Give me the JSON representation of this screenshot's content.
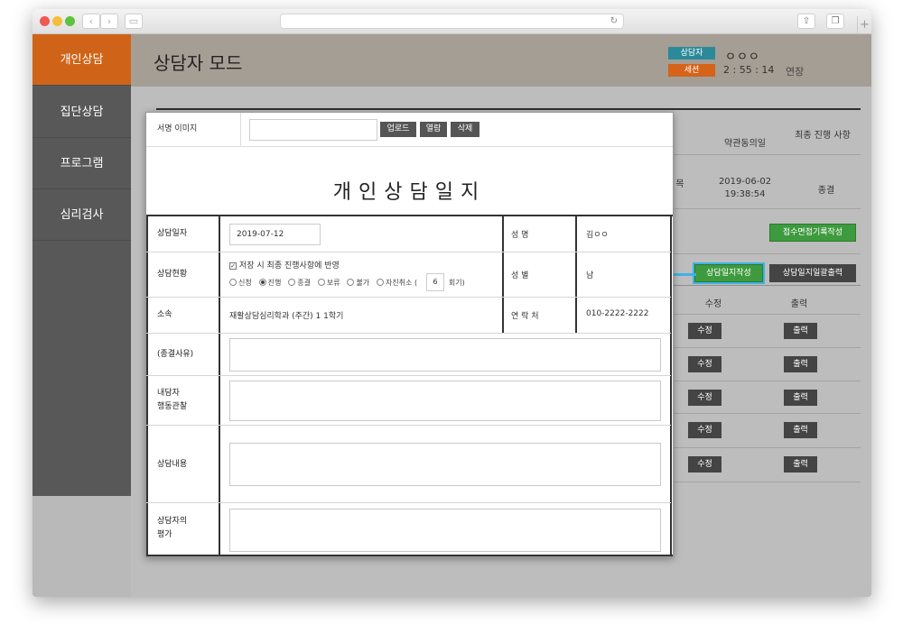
{
  "sidebar": {
    "items": [
      {
        "label": "개인상담"
      },
      {
        "label": "집단상담"
      },
      {
        "label": "프로그램"
      },
      {
        "label": "심리검사"
      }
    ]
  },
  "header": {
    "title": "상담자 모드",
    "counselor_badge": "상담자",
    "counselor_name": "ㅇㅇㅇ",
    "session_badge": "세션",
    "session_time": "2 : 55 : 14",
    "extend_label": "연장"
  },
  "background_table": {
    "col_consent": "약관동의일",
    "col_final": "최종 진행 사항",
    "partial_cell": "목",
    "consent_date": "2019-06-02 19:38:54",
    "final_status": "종결",
    "intake_button": "접수면접기록작성",
    "log_write_button": "상담일지작성",
    "log_print_all_button": "상담일지일괄출력",
    "col_edit": "수정",
    "col_print": "출력",
    "edit_label": "수정",
    "print_label": "출력",
    "row_count": 5
  },
  "modal": {
    "signature_label": "서명 이미지",
    "upload_button": "업로드",
    "view_button": "열람",
    "delete_button": "삭제",
    "form_title": "개인상담일지",
    "rows": {
      "date_label": "상담일자",
      "date_value": "2019-07-12",
      "name_label": "성    명",
      "name_value": "김ㅇㅇ",
      "status_label": "상담현황",
      "save_checkbox_label": "저장 시 최종 진행사항에 반영",
      "status_options": [
        "신청",
        "진행",
        "종결",
        "보류",
        "불가",
        "자진취소 ("
      ],
      "selected_status": "진행",
      "session_count": "6",
      "session_suffix": "회기)",
      "gender_label": "성    별",
      "gender_value": "남",
      "affiliation_label": "소속",
      "affiliation_value": "재활상담심리학과 (주간) 1 1학기",
      "contact_label": "연 락 처",
      "contact_value": "010-2222-2222",
      "termination_reason_label": "(종결사유)",
      "behavior_label_1": "내담자",
      "behavior_label_2": "행동관찰",
      "content_label": "상담내용",
      "evaluation_label_1": "상담자의",
      "evaluation_label_2": "평가"
    }
  }
}
